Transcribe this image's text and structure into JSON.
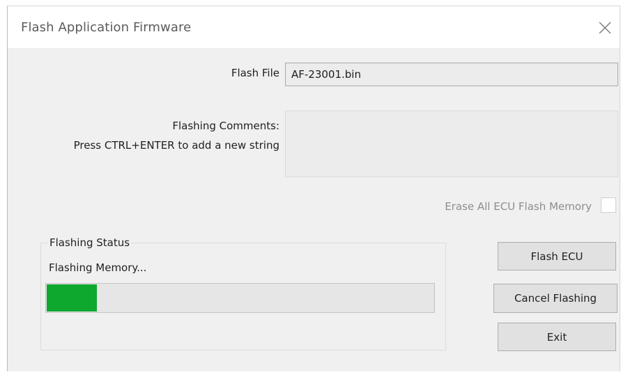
{
  "window": {
    "title": "Flash Application Firmware"
  },
  "flash_file": {
    "label": "Flash File",
    "value": "AF-23001.bin"
  },
  "comments": {
    "label_line1": "Flashing Comments:",
    "label_line2": "Press CTRL+ENTER to add a new string",
    "value": ""
  },
  "erase": {
    "label": "Erase All ECU Flash Memory",
    "checked": false
  },
  "status": {
    "group_label": "Flashing Status",
    "text": "Flashing Memory...",
    "progress": 0.13,
    "progress_color": "#0fa82f"
  },
  "buttons": {
    "flash": "Flash ECU",
    "cancel": "Cancel Flashing",
    "exit": "Exit"
  },
  "icons": {
    "close": "close-icon"
  }
}
